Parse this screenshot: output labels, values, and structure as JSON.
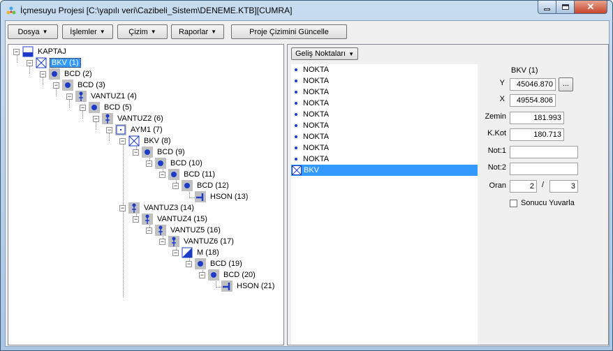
{
  "window": {
    "title": "İçmesuyu Projesi  [C:\\yapılı veri\\Cazibeli_Sistem\\DENEME.KTB][CUMRA]"
  },
  "toolbar": {
    "menus": [
      "Dosya",
      "İşlemler",
      "Çizim",
      "Raporlar"
    ],
    "update_button": "Proje Çizimini Güncelle"
  },
  "tree": {
    "nodes": [
      {
        "label": "KAPTAJ",
        "type": "kaptaj"
      },
      {
        "label": "BKV (1)",
        "type": "bkv",
        "selected": true
      },
      {
        "label": "BCD (2)",
        "type": "bcd"
      },
      {
        "label": "BCD (3)",
        "type": "bcd"
      },
      {
        "label": "VANTUZ1 (4)",
        "type": "vantuz"
      },
      {
        "label": "BCD (5)",
        "type": "bcd"
      },
      {
        "label": "VANTUZ2 (6)",
        "type": "vantuz"
      },
      {
        "label": "AYM1 (7)",
        "type": "aym"
      },
      {
        "label": "BKV (8)",
        "type": "bkv"
      },
      {
        "label": "BCD (9)",
        "type": "bcd"
      },
      {
        "label": "BCD (10)",
        "type": "bcd"
      },
      {
        "label": "BCD (11)",
        "type": "bcd"
      },
      {
        "label": "BCD (12)",
        "type": "bcd"
      },
      {
        "label": "HSON (13)",
        "type": "hson"
      },
      {
        "label": "VANTUZ3 (14)",
        "type": "vantuz"
      },
      {
        "label": "VANTUZ4 (15)",
        "type": "vantuz"
      },
      {
        "label": "VANTUZ5 (16)",
        "type": "vantuz"
      },
      {
        "label": "VANTUZ6 (17)",
        "type": "vantuz"
      },
      {
        "label": "M (18)",
        "type": "m"
      },
      {
        "label": "BCD (19)",
        "type": "bcd"
      },
      {
        "label": "BCD (20)",
        "type": "bcd"
      },
      {
        "label": "HSON (21)",
        "type": "hson"
      }
    ]
  },
  "gelis": {
    "dropdown": "Geliş Noktaları",
    "items": [
      "NOKTA",
      "NOKTA",
      "NOKTA",
      "NOKTA",
      "NOKTA",
      "NOKTA",
      "NOKTA",
      "NOKTA",
      "NOKTA",
      "BKV"
    ]
  },
  "props": {
    "header": "BKV (1)",
    "y_label": "Y",
    "y_value": "45046.870",
    "dots": "...",
    "x_label": "X",
    "x_value": "49554.806",
    "zemin_label": "Zemin",
    "zemin_value": "181.993",
    "kkot_label": "K.Kot",
    "kkot_value": "180.713",
    "not1_label": "Not:1",
    "not1_value": "",
    "not2_label": "Not:2",
    "not2_value": "",
    "oran_label": "Oran",
    "oran_num": "2",
    "oran_sep": "/",
    "oran_den": "3",
    "round_label": "Sonucu Yuvarla"
  },
  "colors": {
    "accent": "#3399ff",
    "node_blue": "#1c3cc8",
    "node_bg": "#c0c0c0"
  }
}
